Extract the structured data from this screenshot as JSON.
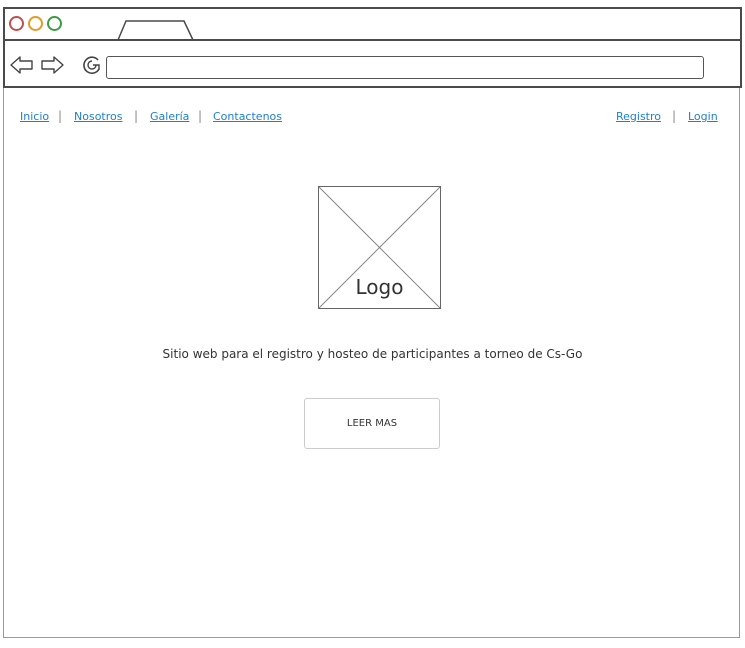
{
  "colors": {
    "link": "#1f80cf",
    "window_close": "#c0504d",
    "window_minimize": "#e39a2c",
    "window_maximize": "#3a9e3f",
    "frame": "#4a4a4a"
  },
  "browser": {
    "window_controls": [
      {
        "icon": "close-circle-icon"
      },
      {
        "icon": "minimize-circle-icon"
      },
      {
        "icon": "maximize-circle-icon"
      }
    ],
    "toolbar_icons": [
      "back-arrow-icon",
      "forward-arrow-icon",
      "reload-icon"
    ],
    "address_bar": {
      "value": ""
    }
  },
  "nav": {
    "separator": "|",
    "left": [
      {
        "label": "Inicio"
      },
      {
        "label": "Nosotros"
      },
      {
        "label": "Galería"
      },
      {
        "label": "Contactenos"
      }
    ],
    "right": [
      {
        "label": "Registro"
      },
      {
        "label": "Login"
      }
    ]
  },
  "logo": {
    "label": "Logo"
  },
  "description": "Sitio web para el registro y hosteo de participantes a torneo de Cs-Go",
  "cta": {
    "label": "LEER MAS"
  }
}
